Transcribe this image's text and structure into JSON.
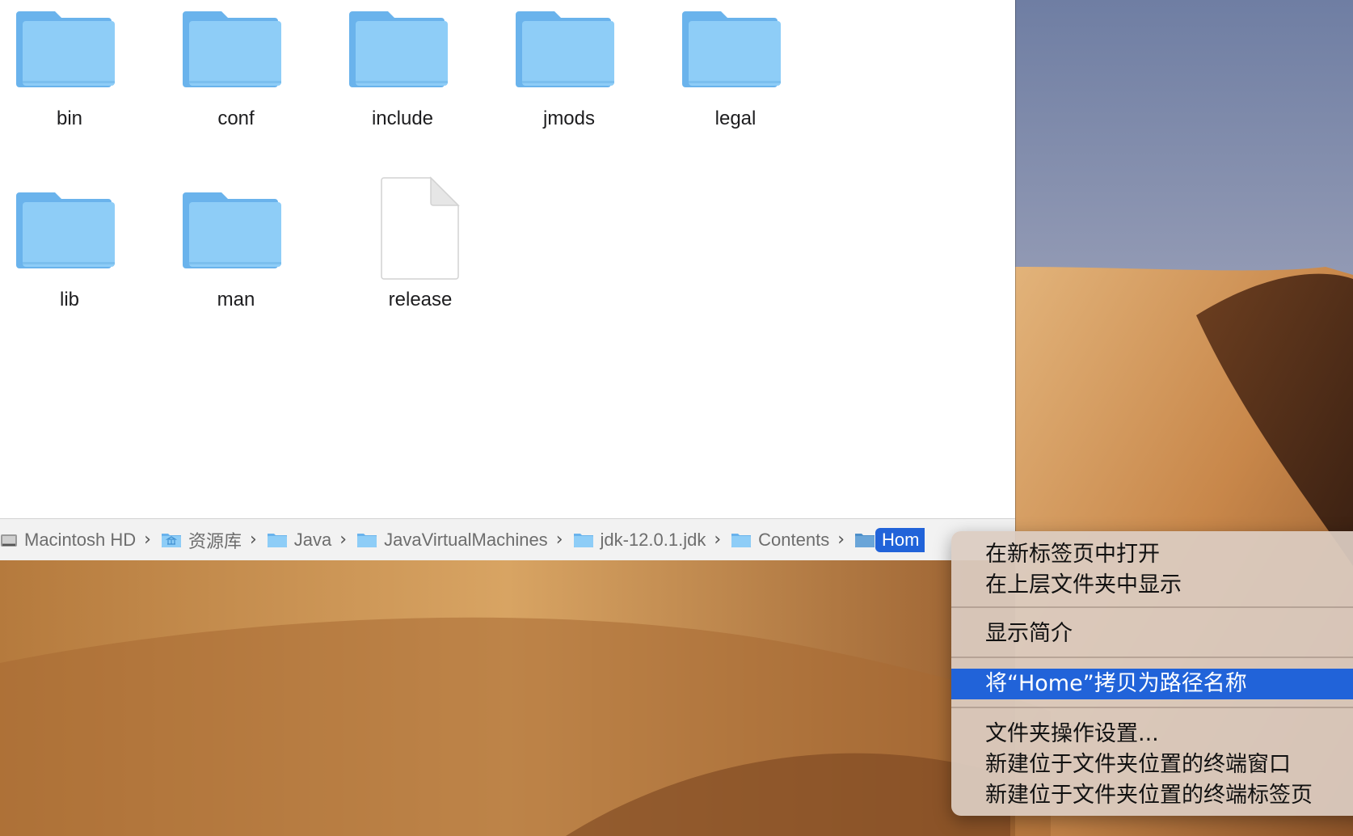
{
  "finder": {
    "items": [
      {
        "name": "bin",
        "kind": "folder"
      },
      {
        "name": "conf",
        "kind": "folder"
      },
      {
        "name": "include",
        "kind": "folder"
      },
      {
        "name": "jmods",
        "kind": "folder"
      },
      {
        "name": "legal",
        "kind": "folder"
      },
      {
        "name": "lib",
        "kind": "folder"
      },
      {
        "name": "man",
        "kind": "folder"
      },
      {
        "name": "release",
        "kind": "document"
      }
    ],
    "pathbar": [
      {
        "label": "Macintosh HD",
        "icon": "hard-drive-icon"
      },
      {
        "label": "资源库",
        "icon": "library-folder-icon"
      },
      {
        "label": "Java",
        "icon": "folder-icon"
      },
      {
        "label": "JavaVirtualMachines",
        "icon": "folder-icon"
      },
      {
        "label": "jdk-12.0.1.jdk",
        "icon": "folder-icon"
      },
      {
        "label": "Contents",
        "icon": "folder-icon"
      },
      {
        "label": "Hom",
        "icon": "folder-icon"
      }
    ],
    "separator_glyph": "›"
  },
  "context_menu": {
    "groups": [
      [
        "在新标签页中打开",
        "在上层文件夹中显示"
      ],
      [
        "显示简介"
      ],
      [
        "将“Home”拷贝为路径名称"
      ],
      [
        "文件夹操作设置...",
        "新建位于文件夹位置的终端窗口",
        "新建位于文件夹位置的终端标签页"
      ]
    ],
    "highlighted": "将“Home”拷贝为路径名称"
  },
  "colors": {
    "folder_light": "#8ecdf7",
    "folder_dark": "#6ab3ec",
    "selection": "#2163d9",
    "pathbar_bg": "#f2f2f2"
  }
}
